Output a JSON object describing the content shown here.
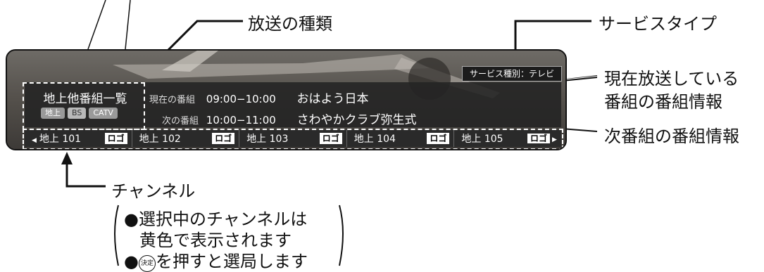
{
  "callouts": {
    "broadcast_type": "放送の種類",
    "service_type": "サービスタイプ",
    "current_info_line1": "現在放送している",
    "current_info_line2": "番組の番組情報",
    "next_info": "次番組の番組情報",
    "channel": "チャンネル",
    "channel_note1": "●選択中のチャンネルは",
    "channel_note2": "黄色で表示されます",
    "channel_note3_pre": "●",
    "channel_note3_button": "決定",
    "channel_note3_post": "を押すと選局します"
  },
  "screen": {
    "service_badge": "サービス種別：テレビ",
    "list_title": "地上他番組一覧",
    "types": [
      "地上",
      "BS",
      "CATV"
    ],
    "current_label": "現在の番組",
    "current_time": "09:00−10:00",
    "current_title": "おはよう日本",
    "next_label": "次の番組",
    "next_time": "10:00−11:00",
    "next_title": "さわやかクラブ弥生式",
    "left_arrow": "◀",
    "right_arrow": "▶",
    "channels": [
      {
        "name": "地上 101",
        "logo": "ロゴ"
      },
      {
        "name": "地上 102",
        "logo": "ロゴ"
      },
      {
        "name": "地上 103",
        "logo": "ロゴ"
      },
      {
        "name": "地上 104",
        "logo": "ロゴ"
      },
      {
        "name": "地上 105",
        "logo": "ロゴ"
      }
    ]
  },
  "colors": {
    "panel": "#232323",
    "badge": "#1c1c1c",
    "logo_bg": "#ffffff"
  }
}
